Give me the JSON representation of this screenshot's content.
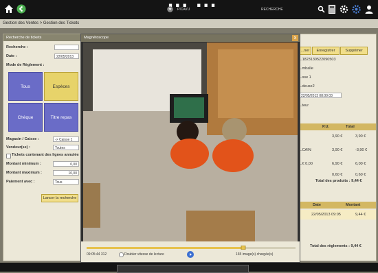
{
  "topbar": {
    "banner": "... ...",
    "app_name": "PICAVU",
    "search_label": "RECHERCHE"
  },
  "breadcrumb": "Gestion des Ventes > Gestion des Tickets",
  "search_panel": {
    "title": "Recherche de tickets",
    "recherche_label": "Recherche :",
    "recherche_value": "",
    "date_label": "Date :",
    "date_value": "22/05/2013",
    "mode_label": "Mode de Règlement :",
    "pay_buttons": [
      "Tous",
      "Espèces",
      "Chèque",
      "Titre repas"
    ],
    "magasin_label": "Magasin / Caisse :",
    "magasin_value": "-> Caisse 1",
    "vendeur_label": "Vendeur(se) :",
    "vendeur_value": "Toutes",
    "tickets_check_label": "Tickets contenant des lignes annulées",
    "montant_min_label": "Montant minimum :",
    "montant_min_value": "0,00",
    "montant_max_label": "Montant maximum :",
    "montant_max_value": "10,00",
    "paiement_label": "Paiement avec :",
    "paiement_value": "Tous",
    "launch_button": "Lancer la recherche"
  },
  "ticket_panel": {
    "buttons": [
      "...ner",
      "Enregistrer",
      "Supprimer"
    ],
    "lines": [
      "...1823130522090503",
      "...mballe",
      "...sse 1",
      "...deuse2"
    ],
    "date_value": "22/05/2013 08:00:03",
    "section_label": "...teur",
    "table_headers": [
      "P.U.",
      "Total"
    ],
    "rows": [
      {
        "label": "",
        "pu": "3,90 €",
        "total": "3,90 €"
      },
      {
        "label": "...CAIN",
        "pu": "3,90 €",
        "total": "-3,90 €"
      },
      {
        "label": "...€ 0,00",
        "pu": "6,90 €",
        "total": "6,00 €"
      },
      {
        "label": "",
        "pu": "0,60 €",
        "total": "0,60 €"
      }
    ],
    "total_products": "Total des produits : 9,44 €",
    "payment_headers": [
      "Date",
      "Montant"
    ],
    "payment_row": {
      "date": "22/05/2013 09:05",
      "montant": "9,44 €"
    },
    "total_payments": "Total des règlements : 9,44 €"
  },
  "video_window": {
    "title": "Magnétoscope",
    "close": "x",
    "timecode": "09:05:44 312",
    "double_speed_label": "Doubler vitesse de lecture",
    "images_loaded": "165 image(s) chargée(s)",
    "progress": 0.75
  }
}
